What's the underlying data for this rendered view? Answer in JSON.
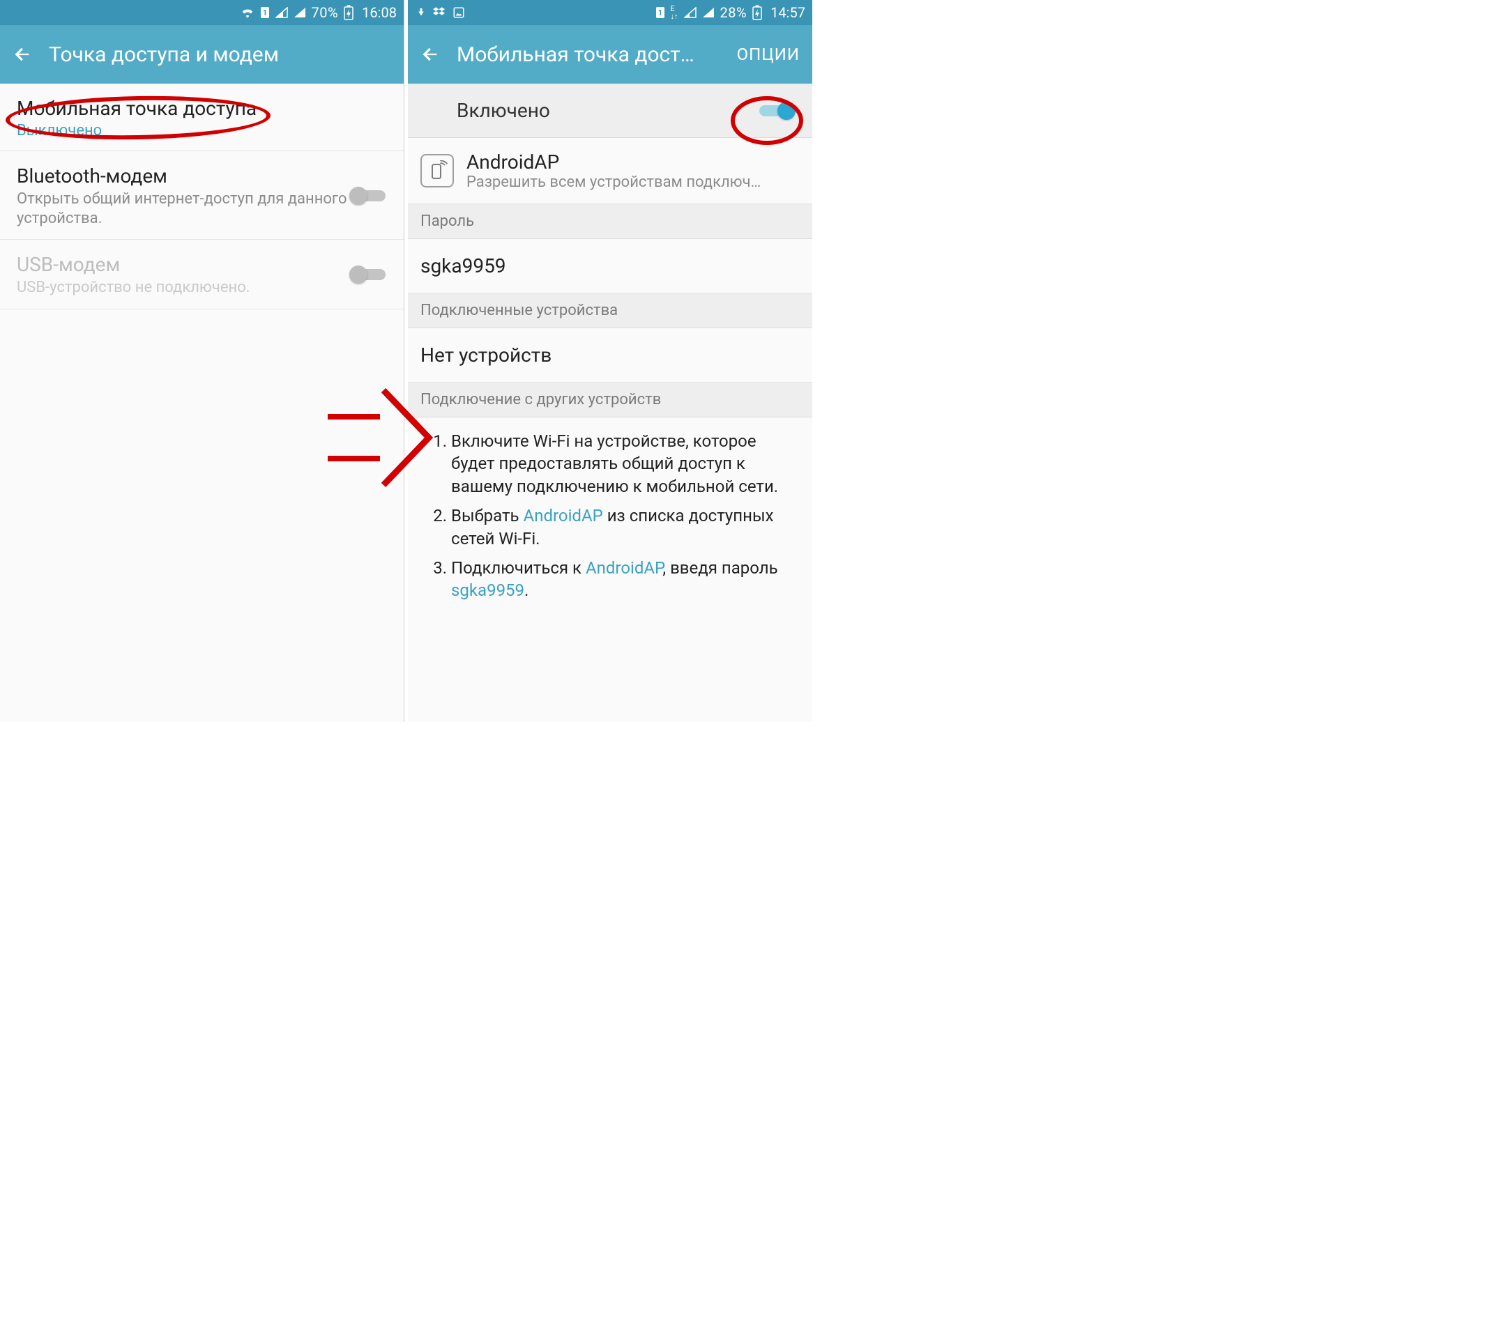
{
  "left": {
    "status": {
      "battery": "70%",
      "time": "16:08"
    },
    "appbar": {
      "title": "Точка доступа и модем"
    },
    "items": {
      "hotspot": {
        "title": "Мобильная точка доступа",
        "status": "Выключено"
      },
      "bt": {
        "title": "Bluetooth-модем",
        "desc": "Открыть общий интернет-доступ для данного устройства."
      },
      "usb": {
        "title": "USB-модем",
        "desc": "USB-устройство не подключено."
      }
    }
  },
  "right": {
    "status": {
      "battery": "28%",
      "time": "14:57"
    },
    "appbar": {
      "title": "Мобильная точка дост…",
      "action": "ОПЦИИ"
    },
    "enable_label": "Включено",
    "ap": {
      "name": "AndroidAP",
      "desc": "Разрешить всем устройствам подключ…"
    },
    "sections": {
      "password_header": "Пароль",
      "password_value": "sgka9959",
      "connected_header": "Подключенные устройства",
      "connected_value": "Нет устройств",
      "howto_header": "Подключение с других устройств"
    },
    "instructions": {
      "step1": "Включите Wi-Fi на устройстве, которое будет предоставлять общий доступ к вашему подключению к мобильной сети.",
      "step2_a": "Выбрать ",
      "step2_link": "AndroidAP",
      "step2_b": " из списка доступных сетей Wi-Fi.",
      "step3_a": "Подключиться к ",
      "step3_link1": "AndroidAP",
      "step3_b": ", введя пароль ",
      "step3_link2": "sgka9959",
      "step3_c": "."
    }
  }
}
